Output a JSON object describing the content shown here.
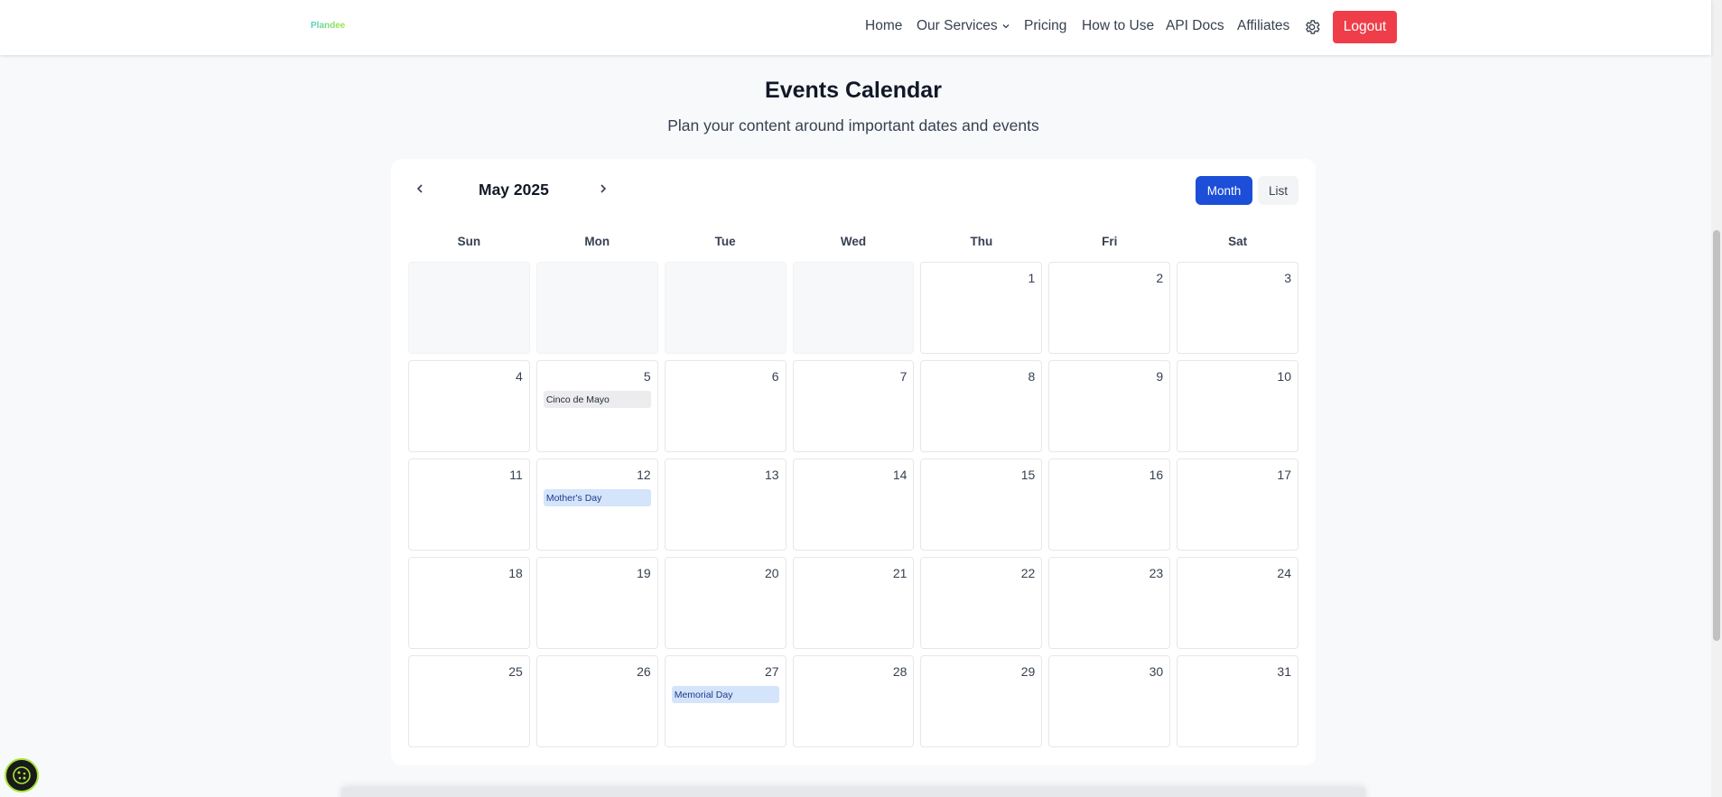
{
  "header": {
    "logo_text": "Plandee",
    "nav": [
      {
        "label": "Home"
      },
      {
        "label": "Our Services"
      },
      {
        "label": "Pricing"
      },
      {
        "label": "How to Use"
      },
      {
        "label": "API Docs"
      },
      {
        "label": "Affiliates"
      }
    ],
    "logout_label": "Logout",
    "logout_color": "#ef3e4a"
  },
  "page": {
    "title": "Events Calendar",
    "subtitle": "Plan your content around important dates and events"
  },
  "calendar": {
    "month_label": "May 2025",
    "views": {
      "month": "Month",
      "list": "List"
    },
    "active_view": "Month",
    "accent_color": "#1d4ed8",
    "weekdays": [
      "Sun",
      "Mon",
      "Tue",
      "Wed",
      "Thu",
      "Fri",
      "Sat"
    ],
    "cells": [
      {
        "day": "",
        "empty": true
      },
      {
        "day": "",
        "empty": true
      },
      {
        "day": "",
        "empty": true
      },
      {
        "day": "",
        "empty": true
      },
      {
        "day": "1"
      },
      {
        "day": "2"
      },
      {
        "day": "3"
      },
      {
        "day": "4"
      },
      {
        "day": "5",
        "event": {
          "label": "Cinco de Mayo",
          "style": "gray"
        }
      },
      {
        "day": "6"
      },
      {
        "day": "7"
      },
      {
        "day": "8"
      },
      {
        "day": "9"
      },
      {
        "day": "10"
      },
      {
        "day": "11"
      },
      {
        "day": "12",
        "event": {
          "label": "Mother's Day",
          "style": "blue"
        }
      },
      {
        "day": "13"
      },
      {
        "day": "14"
      },
      {
        "day": "15"
      },
      {
        "day": "16"
      },
      {
        "day": "17"
      },
      {
        "day": "18"
      },
      {
        "day": "19"
      },
      {
        "day": "20"
      },
      {
        "day": "21"
      },
      {
        "day": "22"
      },
      {
        "day": "23"
      },
      {
        "day": "24"
      },
      {
        "day": "25"
      },
      {
        "day": "26"
      },
      {
        "day": "27",
        "event": {
          "label": "Memorial Day",
          "style": "blue"
        }
      },
      {
        "day": "28"
      },
      {
        "day": "29"
      },
      {
        "day": "30"
      },
      {
        "day": "31"
      }
    ]
  },
  "icons": {
    "prev": "chevron-left-icon",
    "next": "chevron-right-icon",
    "settings": "gear-icon",
    "services_dropdown": "chevron-down-icon",
    "cookie": "cookie-icon"
  }
}
